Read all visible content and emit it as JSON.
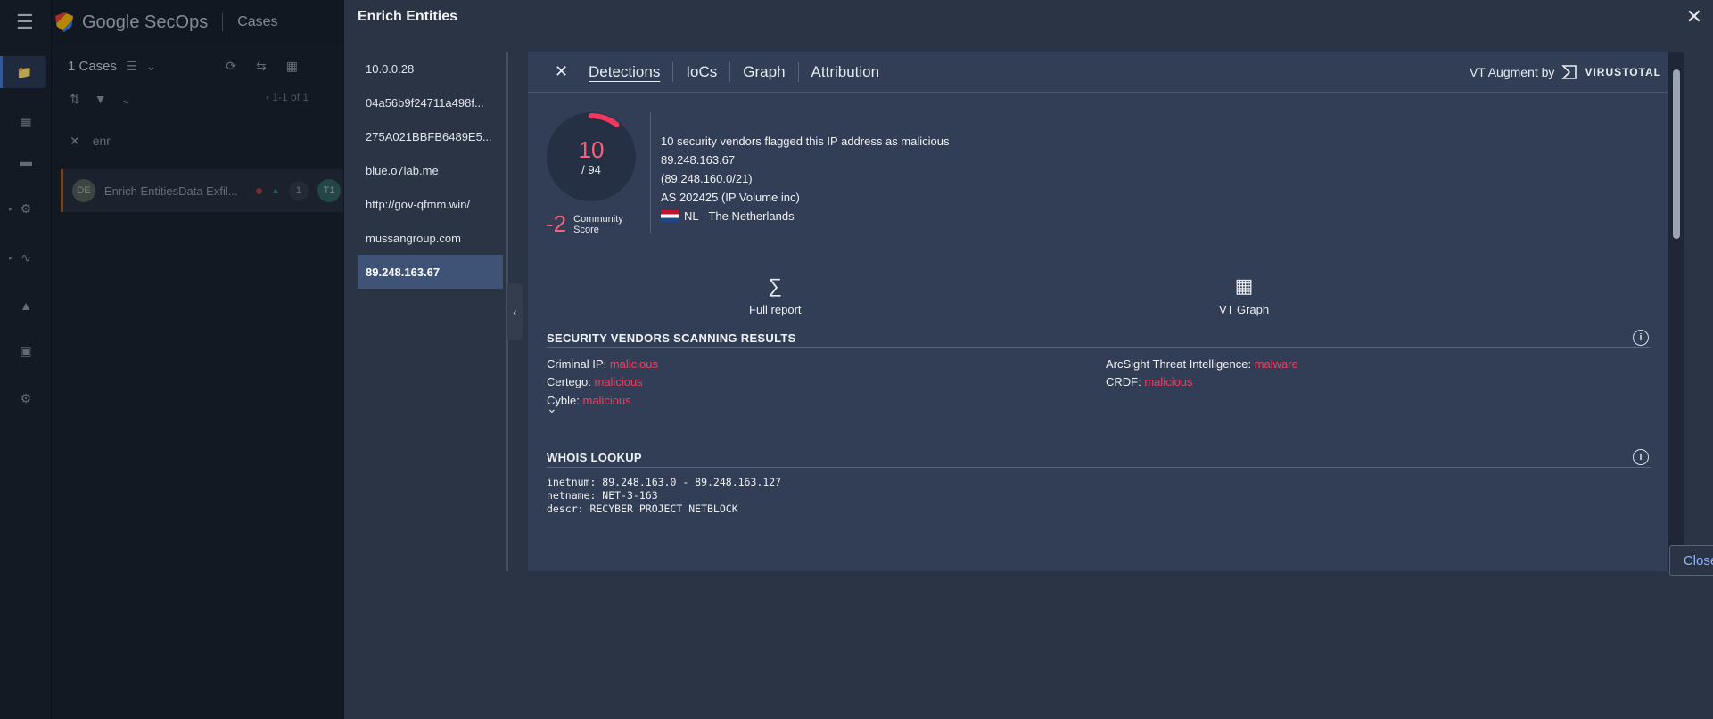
{
  "app": {
    "brand": "Google SecOps",
    "section": "Cases"
  },
  "cases": {
    "count_label": "1 Cases",
    "pager": "1-1 of 1",
    "search_value": "enr",
    "case_card": {
      "avatar": "DE",
      "title": "Enrich EntitiesData Exfil...",
      "count": "1",
      "tag": "T1"
    }
  },
  "modal": {
    "title": "Enrich Entities",
    "close_label": "Close",
    "entities": [
      "10.0.0.28",
      "04a56b9f24711a498f...",
      "275A021BBFB6489E5...",
      "blue.o7lab.me",
      "http://gov-qfmm.win/",
      "mussangroup.com",
      "89.248.163.67"
    ],
    "active_entity_index": 6
  },
  "vt": {
    "tabs": [
      "Detections",
      "IoCs",
      "Graph",
      "Attribution"
    ],
    "active_tab": "Detections",
    "augment_label": "VT Augment by",
    "augment_brand": "VIRUSTOTAL",
    "score": {
      "detections": "10",
      "total": "/ 94",
      "fraction": 0.106
    },
    "community": {
      "score": "-2",
      "label_line1": "Community",
      "label_line2": "Score"
    },
    "info_lines": [
      "10 security vendors flagged this IP address as malicious",
      "89.248.163.67",
      "(89.248.160.0/21)",
      "AS 202425  (IP Volume inc)"
    ],
    "country": "NL - The Netherlands",
    "actions": {
      "full_report": "Full report",
      "vt_graph": "VT Graph"
    },
    "vendors_title": "SECURITY VENDORS SCANNING RESULTS",
    "vendors": [
      {
        "name": "Criminal IP:",
        "result": "malicious"
      },
      {
        "name": "ArcSight Threat Intelligence:",
        "result": "malware"
      },
      {
        "name": "Certego:",
        "result": "malicious"
      },
      {
        "name": "CRDF:",
        "result": "malicious"
      },
      {
        "name": "Cyble:",
        "result": "malicious"
      }
    ],
    "whois_title": "WHOIS LOOKUP",
    "whois_lines": [
      "inetnum: 89.248.163.0 - 89.248.163.127",
      "netname: NET-3-163",
      "descr: RECYBER PROJECT NETBLOCK"
    ]
  },
  "colors": {
    "accent": "#4a7bd0",
    "malicious": "#ef3e62",
    "score": "#f2637c"
  }
}
